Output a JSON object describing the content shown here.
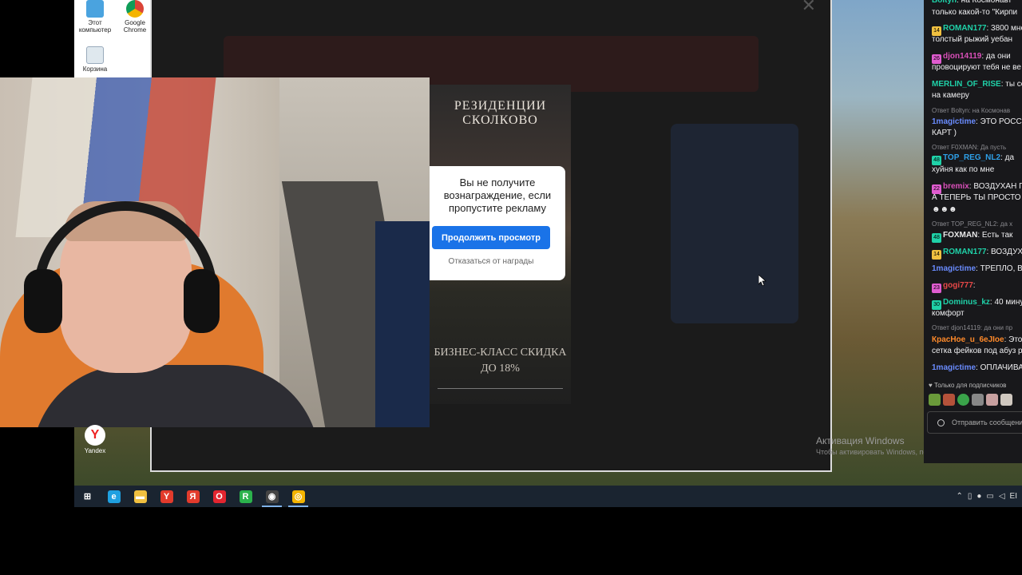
{
  "desktop": {
    "icons": [
      {
        "label": "Этот компьютер"
      },
      {
        "label": "Google Chrome"
      },
      {
        "label": "Корзина"
      }
    ],
    "yandex_label": "Yandex"
  },
  "browser": {
    "close_glyph": "✕",
    "watermark_title": "Активация Windows",
    "watermark_sub": "Чтобы активировать Windows, перейдите в раздел \"Пар"
  },
  "ad": {
    "title": "РЕЗИДЕНЦИИ СКОЛКОВО",
    "subtitle": "БИЗНЕС-КЛАСС СКИДКА ДО 18%"
  },
  "dialog": {
    "message": "Вы не получите вознаграждение, если пропустите рекламу",
    "continue_label": "Продолжить просмотр",
    "decline_label": "Отказаться от награды"
  },
  "taskbar": {
    "items": [
      {
        "icon": "windows-start-icon",
        "glyph": "⊞",
        "color": "#ffffff"
      },
      {
        "icon": "edge-icon",
        "glyph": "e",
        "color": "#1fa0e0"
      },
      {
        "icon": "file-explorer-icon",
        "glyph": "▬",
        "color": "#f0c040"
      },
      {
        "icon": "yandex-icon",
        "glyph": "Y",
        "color": "#e23b2c"
      },
      {
        "icon": "yandex-browser-icon",
        "glyph": "Я",
        "color": "#e23b2c"
      },
      {
        "icon": "opera-icon",
        "glyph": "O",
        "color": "#e3252f"
      },
      {
        "icon": "razer-icon",
        "glyph": "R",
        "color": "#2bb24c"
      },
      {
        "icon": "obs-icon",
        "glyph": "◉",
        "color": "#444444"
      },
      {
        "icon": "chrome-icon",
        "glyph": "◎",
        "color": "#f4b400"
      }
    ],
    "lang": "ЕІ"
  },
  "chat": {
    "lines": [
      {
        "type": "msg",
        "user": "Boltyn",
        "user_color": "#1fd1a8",
        "text": " на Космонавт"
      },
      {
        "type": "cont",
        "text": "только какой-то \"Кирпи"
      },
      {
        "type": "msg",
        "badge": "14",
        "badge_color": "#f0c040",
        "user": "ROMAN177",
        "user_color": "#1fd1a8",
        "text": " 3800 мне"
      },
      {
        "type": "cont",
        "text": "толстый рыжий уебан"
      },
      {
        "type": "msg",
        "badge": "26",
        "badge_color": "#e05cd0",
        "user": "djon14119",
        "user_color": "#d94fb8",
        "text": " да они"
      },
      {
        "type": "cont",
        "text": "провоцируют тебя не ве"
      },
      {
        "type": "msg",
        "user": "MERLIN_OF_RISE",
        "user_color": "#1fd1a8",
        "text": " ты сс"
      },
      {
        "type": "cont",
        "text": "на камеру"
      },
      {
        "type": "reply",
        "text": "Ответ Boltyn: на Космонав"
      },
      {
        "type": "msg",
        "user": "1magictime",
        "user_color": "#6a8cff",
        "text": " ЭТО РОССЭ"
      },
      {
        "type": "cont",
        "text": "КАРТ )"
      },
      {
        "type": "reply",
        "text": "Ответ F0XMAN: Да пусть"
      },
      {
        "type": "msg",
        "badge": "48",
        "badge_color": "#1fd1a8",
        "user": "TOP_REG_NL2",
        "user_color": "#2ea0e8",
        "text": " да"
      },
      {
        "type": "cont",
        "text": "хуйня как по мне"
      },
      {
        "type": "msg",
        "badge": "22",
        "badge_color": "#e05cd0",
        "user": "bremix",
        "user_color": "#d94fb8",
        "text": " ВОЗДУХАН П"
      },
      {
        "type": "cont",
        "text": "А ТЕПЕРЬ ТЫ ПРОСТО П"
      },
      {
        "type": "cont",
        "text": "☻☻☻"
      },
      {
        "type": "reply",
        "text": "Ответ TOP_REG_NL2: да х"
      },
      {
        "type": "msg",
        "badge": "48",
        "badge_color": "#1fd1a8",
        "user": "FOXMAN",
        "user_color": "#e8e8e8",
        "text": " Есть так"
      },
      {
        "type": "msg",
        "badge": "14",
        "badge_color": "#f0c040",
        "user": "ROMAN177",
        "user_color": "#1fd1a8",
        "text": " ВОЗДУХ"
      },
      {
        "type": "msg",
        "user": "1magictime",
        "user_color": "#6a8cff",
        "text": " ТРЕПЛО, ВЫ"
      },
      {
        "type": "msg",
        "badge": "23",
        "badge_color": "#e05cd0",
        "user": "gogi777",
        "user_color": "#e84848",
        "text": " "
      },
      {
        "type": "msg",
        "badge": "30",
        "badge_color": "#1fd1a8",
        "user": "Dominus_kz",
        "user_color": "#1fd1a8",
        "text": " 40 мину"
      },
      {
        "type": "cont",
        "text": "комфорт"
      },
      {
        "type": "reply",
        "text": "Ответ djon14119: да они пр"
      },
      {
        "type": "msg",
        "user": "КрасНое_u_6eJIoe",
        "user_color": "#ff8a2a",
        "text": " Это"
      },
      {
        "type": "cont",
        "text": "сетка фейков под абуз р"
      },
      {
        "type": "msg",
        "user": "1magictime",
        "user_color": "#6a8cff",
        "text": " ОПЛАЧИВА"
      }
    ],
    "subscribers_only": "Только для подписчиков",
    "input_placeholder": "Отправить сообщение"
  }
}
